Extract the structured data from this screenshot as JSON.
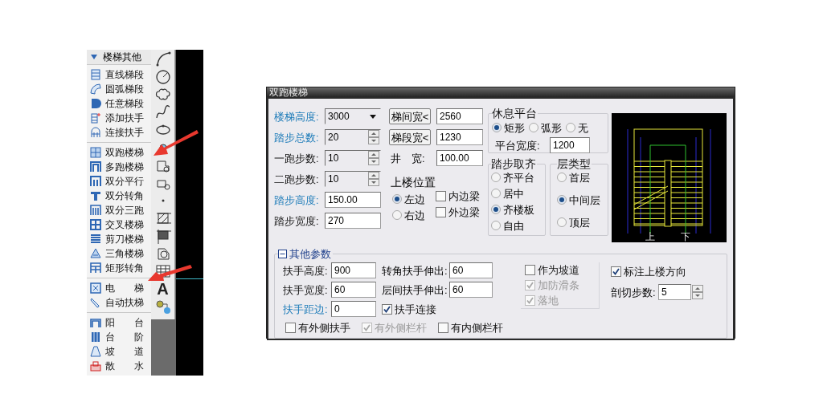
{
  "menu": {
    "header": "楼梯其他",
    "groups": [
      {
        "items": [
          {
            "label": "直线梯段"
          },
          {
            "label": "圆弧梯段"
          },
          {
            "label": "任意梯段"
          },
          {
            "label": "添加扶手"
          },
          {
            "label": "连接扶手"
          }
        ]
      },
      {
        "items": [
          {
            "label": "双跑楼梯"
          },
          {
            "label": "多跑楼梯"
          },
          {
            "label": "双分平行"
          },
          {
            "label": "双分转角"
          },
          {
            "label": "双分三跑"
          },
          {
            "label": "交叉楼梯"
          },
          {
            "label": "剪刀楼梯"
          },
          {
            "label": "三角楼梯"
          },
          {
            "label": "矩形转角"
          }
        ]
      },
      {
        "items": [
          {
            "label": "电 梯"
          },
          {
            "label": "自动扶梯"
          }
        ]
      },
      {
        "items": [
          {
            "label": "阳 台"
          },
          {
            "label": "台 阶"
          },
          {
            "label": "坡 道"
          },
          {
            "label": "散 水"
          }
        ]
      }
    ]
  },
  "toolbar": {
    "text_tool_glyph": "A"
  },
  "dialog": {
    "title": "双跑楼梯",
    "main_fields": [
      {
        "label": "楼梯高度:",
        "value": "3000",
        "highlighted": true,
        "kind": "dropdown"
      },
      {
        "label": "踏步总数:",
        "value": "20",
        "highlighted": true,
        "kind": "spinner"
      },
      {
        "label": "一跑步数:",
        "value": "10",
        "highlighted": false,
        "kind": "spinner"
      },
      {
        "label": "二跑步数:",
        "value": "10",
        "highlighted": false,
        "kind": "spinner"
      },
      {
        "label": "踏步高度:",
        "value": "150.00",
        "highlighted": true,
        "kind": "text"
      },
      {
        "label": "踏步宽度:",
        "value": "270",
        "highlighted": false,
        "kind": "text"
      }
    ],
    "width_fields": [
      {
        "kind": "button",
        "label": "梯间宽<",
        "value": "2560"
      },
      {
        "kind": "button",
        "label": "梯段宽<",
        "value": "1230"
      },
      {
        "kind": "label",
        "label": "井　宽:",
        "value": "100.00"
      }
    ],
    "stair_position": {
      "title": "上楼位置",
      "options": [
        {
          "label": "左边",
          "selected": true
        },
        {
          "label": "右边",
          "selected": false
        }
      ]
    },
    "beams": [
      {
        "label": "内边梁",
        "checked": false
      },
      {
        "label": "外边梁",
        "checked": false
      }
    ],
    "landing": {
      "title": "休息平台",
      "options": [
        {
          "label": "矩形",
          "selected": true
        },
        {
          "label": "弧形",
          "selected": false
        },
        {
          "label": "无",
          "selected": false
        }
      ],
      "width_label": "平台宽度:",
      "width_value": "1200"
    },
    "step_alignment": {
      "title": "踏步取齐",
      "options": [
        {
          "label": "齐平台",
          "selected": false
        },
        {
          "label": "居中",
          "selected": false
        },
        {
          "label": "齐楼板",
          "selected": true
        },
        {
          "label": "自由",
          "selected": false
        }
      ]
    },
    "floor_type": {
      "title": "层类型",
      "options": [
        {
          "label": "首层",
          "selected": false
        },
        {
          "label": "中间层",
          "selected": true
        },
        {
          "label": "顶层",
          "selected": false
        }
      ]
    },
    "preview": {
      "labels": [
        "上",
        "下"
      ]
    },
    "other": {
      "title": "其他参数",
      "expanded": true,
      "fields": [
        {
          "label": "扶手高度:",
          "value": "900",
          "highlighted": false
        },
        {
          "label": "扶手宽度:",
          "value": "60",
          "highlighted": false
        },
        {
          "label": "扶手距边:",
          "value": "0",
          "highlighted": true
        }
      ],
      "extension_fields": [
        {
          "label": "转角扶手伸出:",
          "value": "60"
        },
        {
          "label": "层间扶手伸出:",
          "value": "60"
        }
      ],
      "handrail_connect": {
        "label": "扶手连接",
        "checked": true
      },
      "options": [
        {
          "label": "作为坡道",
          "checked": false,
          "disabled": false
        },
        {
          "label": "加防滑条",
          "checked": true,
          "disabled": true
        },
        {
          "label": "落地",
          "checked": true,
          "disabled": true
        }
      ],
      "mark_direction": {
        "label": "标注上楼方向",
        "checked": true
      },
      "cut_steps": {
        "label": "剖切步数:",
        "value": "5"
      },
      "rails": [
        {
          "label": "有外侧扶手",
          "checked": false,
          "disabled": false
        },
        {
          "label": "有外侧栏杆",
          "checked": true,
          "disabled": true
        },
        {
          "label": "有内侧栏杆",
          "checked": false,
          "disabled": false
        }
      ]
    }
  }
}
